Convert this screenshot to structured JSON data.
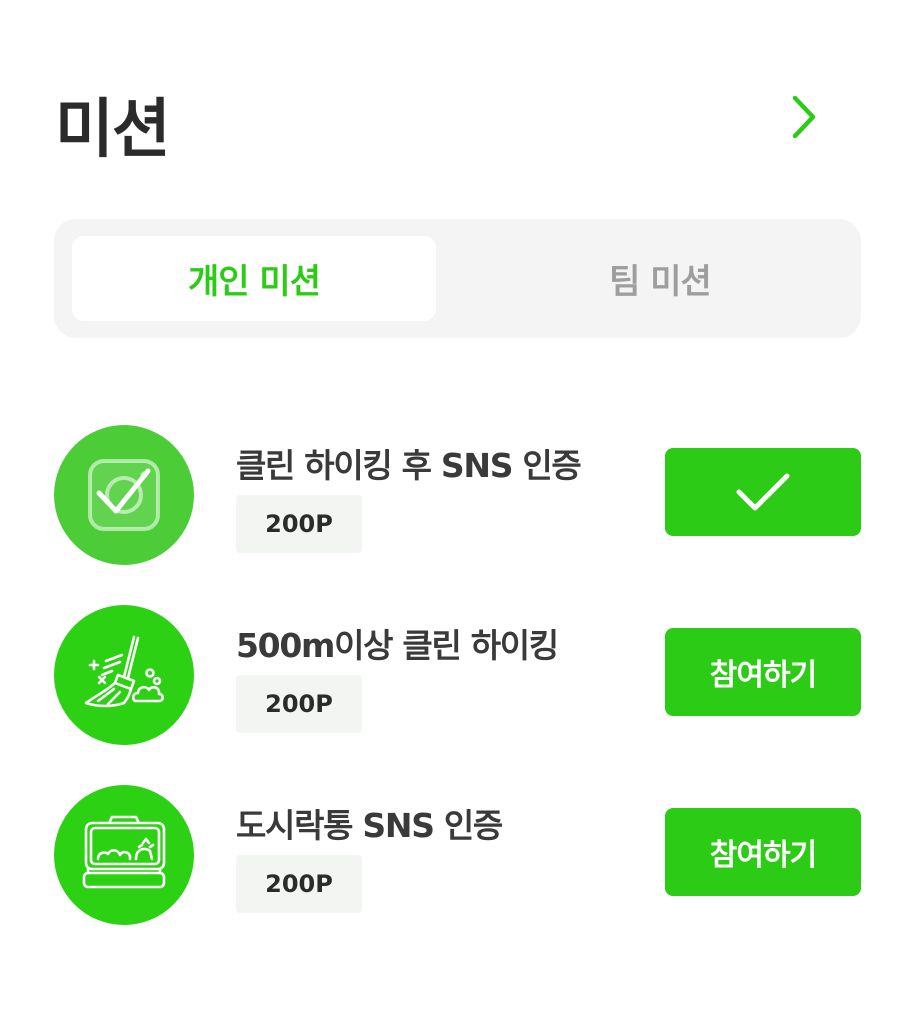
{
  "header": {
    "title": "미션",
    "chevron_icon": "chevron-right-icon",
    "accent_color": "#2ccc16"
  },
  "tabs": [
    {
      "label": "개인 미션",
      "active": true
    },
    {
      "label": "팀 미션",
      "active": false
    }
  ],
  "missions": [
    {
      "title": "클린 하이킹 후 SNS 인증",
      "points": "200P",
      "icon": "instagram-check-icon",
      "status": "completed",
      "button_icon": "checkmark-icon"
    },
    {
      "title": "500m이상 클린 하이킹",
      "points": "200P",
      "icon": "broom-sweeping-icon",
      "status": "available",
      "button_label": "참여하기"
    },
    {
      "title": "도시락통 SNS 인증",
      "points": "200P",
      "icon": "lunchbox-icon",
      "status": "available",
      "button_label": "참여하기"
    }
  ]
}
